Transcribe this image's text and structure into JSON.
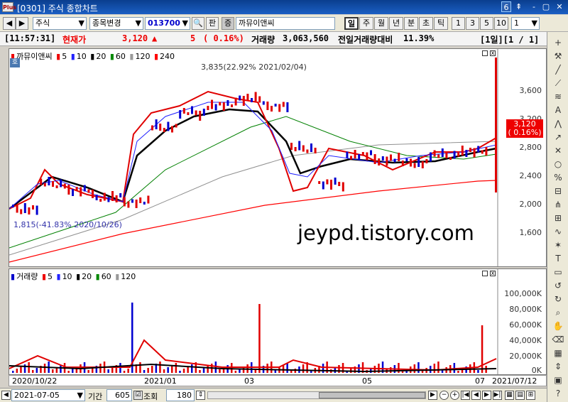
{
  "window": {
    "app_icon": "Plus",
    "title": "[0301] 주식 종합차트",
    "pin": "6",
    "controls": [
      "⇞",
      "-",
      "▢",
      "✕"
    ]
  },
  "toolbar": {
    "market": "주식",
    "mode_label": "종목변경",
    "code": "013700",
    "search_icon": "🔍",
    "pan_label": "판",
    "jeung_label": "증",
    "stock_name": "까뮤이앤씨",
    "periods": [
      "일",
      "주",
      "월",
      "년",
      "분",
      "초",
      "틱"
    ],
    "selected_period": "일",
    "intervals": [
      "1",
      "3",
      "5",
      "10"
    ],
    "count": "1"
  },
  "info": {
    "time": "[11:57:31]",
    "price_label": "현재가",
    "price": "3,120",
    "arrow": "▲",
    "change": "5",
    "change_pct": "( 0.16%)",
    "volume_label": "거래량",
    "volume": "3,063,560",
    "prev_ratio_label": "전일거래량대비",
    "prev_ratio": "11.39%",
    "page": "[1일][1 / 1]"
  },
  "price_panel": {
    "stock": "까뮤이앤씨",
    "ma_labels": [
      "5",
      "10",
      "20",
      "60",
      "120",
      "240"
    ],
    "high_note": "3,835(22.92% 2021/02/04)",
    "low_note": "1,815(-41.83% 2020/10/26)",
    "watermark": "jeypd.tistory.com",
    "current_tag": "3,120",
    "current_tag_pct": "( 0.16%)",
    "y_ticks": [
      "3,600",
      "3,200",
      "2,800",
      "2,400",
      "2,000",
      "1,600"
    ]
  },
  "volume_panel": {
    "title": "거래량",
    "ma_labels": [
      "5",
      "10",
      "20",
      "60",
      "120"
    ],
    "y_ticks": [
      "100,000K",
      "80,000K",
      "60,000K",
      "40,000K",
      "20,000K",
      "0K"
    ]
  },
  "x_axis": {
    "labels": [
      "2020/10/22",
      "2021/01",
      "03",
      "05",
      "07",
      "2021/07/12"
    ]
  },
  "bottom": {
    "date": "2021-07-05",
    "period_label": "기간",
    "period": "605",
    "query_label": "조회",
    "count": "180"
  },
  "colors": {
    "up": "#e00000",
    "down": "#0000d0",
    "ma5": "#e00000",
    "ma10": "#2020ff",
    "ma20": "#000000",
    "ma60": "#008000",
    "ma120": "#909090",
    "ma240": "#ff0000"
  },
  "sidebar_icons": [
    "plus-icon",
    "tool-icon",
    "line-icon",
    "trend-icon",
    "fib-icon",
    "auto-icon",
    "pattern-icon",
    "arrow-icon",
    "cross-icon",
    "circle-icon",
    "percent-icon",
    "ruler-icon",
    "fan-icon",
    "gann-icon",
    "cycle-icon",
    "star-icon",
    "text-icon",
    "rect-icon",
    "rotate-icon",
    "refresh-icon",
    "zoom-icon",
    "hand-icon",
    "del-icon",
    "grid-icon",
    "scale-icon",
    "save-icon",
    "help-icon"
  ]
}
